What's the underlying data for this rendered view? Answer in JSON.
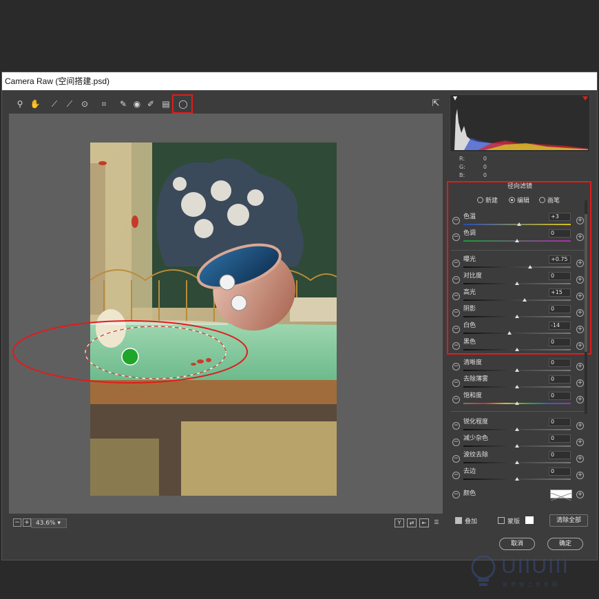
{
  "window": {
    "title": "Camera Raw (空间搭建.psd)"
  },
  "toolbar": {
    "tools": [
      {
        "name": "zoom-tool-icon",
        "glyph": "⚲"
      },
      {
        "name": "hand-tool-icon",
        "glyph": "✋"
      },
      {
        "name": "white-balance-tool-icon",
        "glyph": "⟋"
      },
      {
        "name": "color-sampler-tool-icon",
        "glyph": "⟋"
      },
      {
        "name": "targeted-adjustment-tool-icon",
        "glyph": "⊙"
      },
      {
        "name": "crop-tool-icon",
        "glyph": "⌗"
      },
      {
        "name": "spot-removal-tool-icon",
        "glyph": "✎"
      },
      {
        "name": "red-eye-tool-icon",
        "glyph": "◉"
      },
      {
        "name": "adjustment-brush-icon",
        "glyph": "✐"
      },
      {
        "name": "graduated-filter-icon",
        "glyph": "▤"
      },
      {
        "name": "radial-filter-icon",
        "glyph": "◯"
      }
    ],
    "export_glyph": "⇱"
  },
  "rgb_readout": {
    "r_label": "R:",
    "r_value": "0",
    "g_label": "G:",
    "g_value": "0",
    "b_label": "B:",
    "b_value": "0"
  },
  "filter_panel": {
    "title": "径向滤镜",
    "modes": [
      "新建",
      "编辑",
      "画笔"
    ],
    "selected_mode": "编辑",
    "adjustments": [
      {
        "label": "色温",
        "value": "+3",
        "thumb": 0.52,
        "gradient": "linear-gradient(90deg,#2a4bb0,#d8c418)"
      },
      {
        "label": "色调",
        "value": "0",
        "thumb": 0.5,
        "gradient": "linear-gradient(90deg,#1d9a38,#b02bb0)"
      },
      {
        "label": "曝光",
        "value": "+0.75",
        "thumb": 0.62,
        "gradient": "linear-gradient(90deg,#111,#777)"
      },
      {
        "label": "对比度",
        "value": "0",
        "thumb": 0.5,
        "gradient": "linear-gradient(90deg,#111,#777)"
      },
      {
        "label": "高光",
        "value": "+15",
        "thumb": 0.57,
        "gradient": "linear-gradient(90deg,#111,#777)"
      },
      {
        "label": "阴影",
        "value": "0",
        "thumb": 0.5,
        "gradient": "linear-gradient(90deg,#111,#777)"
      },
      {
        "label": "白色",
        "value": "-14",
        "thumb": 0.43,
        "gradient": "linear-gradient(90deg,#111,#777)"
      },
      {
        "label": "黑色",
        "value": "0",
        "thumb": 0.5,
        "gradient": "linear-gradient(90deg,#111,#777)"
      },
      {
        "label": "清晰度",
        "value": "0",
        "thumb": 0.5,
        "gradient": "linear-gradient(90deg,#111,#777)"
      },
      {
        "label": "去除薄雾",
        "value": "0",
        "thumb": 0.5,
        "gradient": "linear-gradient(90deg,#111,#777)"
      },
      {
        "label": "饱和度",
        "value": "0",
        "thumb": 0.5,
        "gradient": "linear-gradient(90deg,#777,#d03030,#d0c030,#30b030,#3060d0,#a030c0)"
      },
      {
        "label": "锐化程度",
        "value": "0",
        "thumb": 0.5,
        "gradient": "linear-gradient(90deg,#111,#777)"
      },
      {
        "label": "减少杂色",
        "value": "0",
        "thumb": 0.5,
        "gradient": "linear-gradient(90deg,#111,#777)"
      },
      {
        "label": "波纹去除",
        "value": "0",
        "thumb": 0.5,
        "gradient": "linear-gradient(90deg,#111,#777)"
      },
      {
        "label": "去边",
        "value": "0",
        "thumb": 0.5,
        "gradient": "linear-gradient(90deg,#111,#777)"
      }
    ],
    "color_label": "颜色",
    "overlay_label": "叠加",
    "overlay_checked": true,
    "mask_label": "蒙版",
    "mask_checked": false,
    "clear_all": "清除全部"
  },
  "bottom": {
    "zoom_value": "43.6%",
    "zoom_minus": "−",
    "zoom_plus": "+",
    "view_y": "Y"
  },
  "buttons": {
    "cancel": "取消",
    "ok": "确定"
  },
  "watermark": {
    "brand": "UIIUIII",
    "slogan": "自学就上优优网"
  },
  "colors": {
    "highlight_red": "#e21b1b",
    "dialog_bg": "#3c3c3c",
    "preview_bg": "#5f5f5f"
  }
}
